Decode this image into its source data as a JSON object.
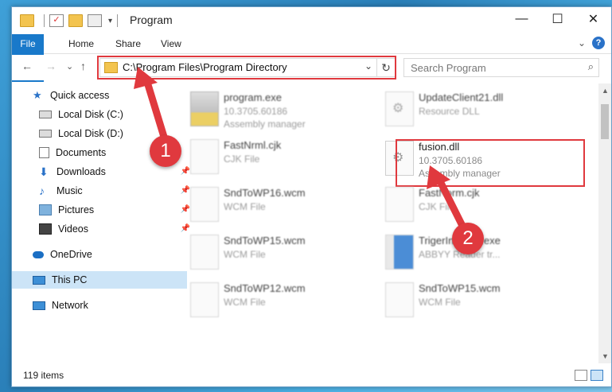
{
  "window": {
    "title": "Program",
    "minimize": "—",
    "maximize": "☐",
    "close": "✕"
  },
  "ribbon": {
    "tabs": [
      "File",
      "Home",
      "Share",
      "View"
    ],
    "help": "?",
    "expand": "⌄"
  },
  "nav": {
    "back": "←",
    "forward": "→",
    "recent": "⌄",
    "up": "↑",
    "address": "C:\\Program Files\\Program Directory",
    "dropdown": "⌄",
    "refresh": "↻",
    "search_placeholder": "Search Program",
    "search_icon": "⌕"
  },
  "sidebar": {
    "items": [
      {
        "label": "Quick access",
        "icon": "star-icon",
        "pinned": false
      },
      {
        "label": "Local Disk (C:)",
        "icon": "drive-icon",
        "pinned": true
      },
      {
        "label": "Local Disk (D:)",
        "icon": "drive-icon",
        "pinned": true
      },
      {
        "label": "Documents",
        "icon": "documents-icon",
        "pinned": true
      },
      {
        "label": "Downloads",
        "icon": "downloads-icon",
        "pinned": true
      },
      {
        "label": "Music",
        "icon": "music-icon",
        "pinned": true
      },
      {
        "label": "Pictures",
        "icon": "pictures-icon",
        "pinned": true
      },
      {
        "label": "Videos",
        "icon": "videos-icon",
        "pinned": true
      },
      {
        "label": "OneDrive",
        "icon": "onedrive-icon",
        "pinned": false
      },
      {
        "label": "This PC",
        "icon": "computer-icon",
        "pinned": false,
        "selected": true
      },
      {
        "label": "Network",
        "icon": "network-icon",
        "pinned": false
      }
    ],
    "pin_glyph": "📌"
  },
  "files": [
    {
      "name": "program.exe",
      "line2": "10.3705.60186",
      "line3": "Assembly manager",
      "type": "exe"
    },
    {
      "name": "UpdateClient21.dll",
      "line2": "Resource DLL",
      "line3": "",
      "type": "dll"
    },
    {
      "name": "FastNrml.cjk",
      "line2": "CJK File",
      "line3": "",
      "type": "doc"
    },
    {
      "name": "fusion.dll",
      "line2": "10.3705.60186",
      "line3": "Assembly manager",
      "type": "dll"
    },
    {
      "name": "SndToWP16.wcm",
      "line2": "WCM File",
      "line3": "",
      "type": "doc"
    },
    {
      "name": "FastNorm.cjk",
      "line2": "CJK File",
      "line3": "",
      "type": "doc"
    },
    {
      "name": "SndToWP15.wcm",
      "line2": "WCM File",
      "line3": "",
      "type": "doc"
    },
    {
      "name": "TrigerInstaller.exe",
      "line2": "ABBYY Reader tr...",
      "line3": "",
      "type": "blue"
    },
    {
      "name": "SndToWP12.wcm",
      "line2": "WCM File",
      "line3": "",
      "type": "doc"
    },
    {
      "name": "SndToWP15.wcm",
      "line2": "WCM File",
      "line3": "",
      "type": "doc"
    }
  ],
  "status": {
    "count": "119 items"
  },
  "callouts": [
    "1",
    "2"
  ],
  "colors": {
    "accent": "#1979ca",
    "highlight": "#e0393e",
    "selected": "#cce4f7"
  }
}
